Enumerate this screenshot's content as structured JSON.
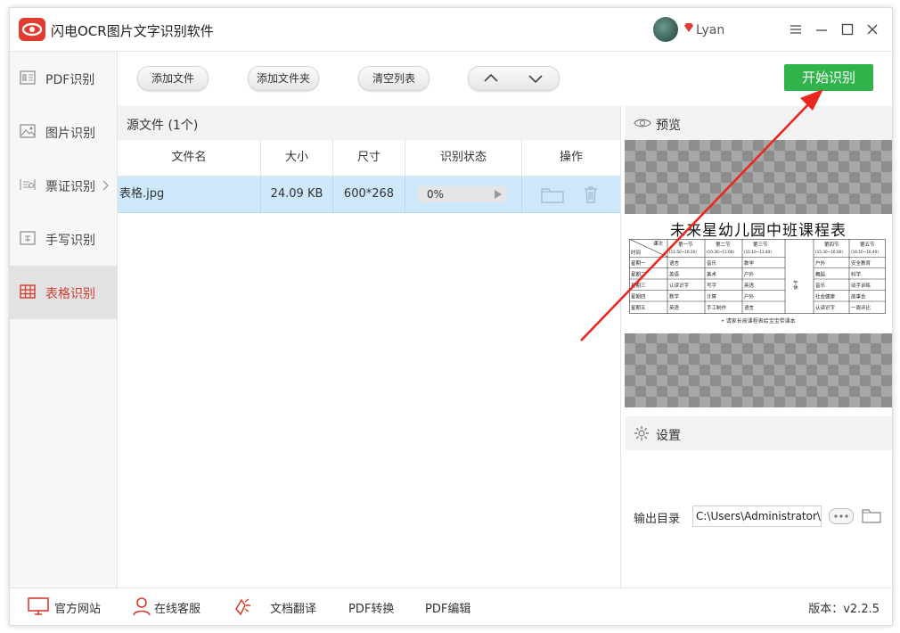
{
  "window": {
    "title": "闪电OCR图片文字识别软件",
    "username": "Lyan",
    "controls": [
      "menu",
      "minimize",
      "maximize",
      "close"
    ]
  },
  "sidebar": {
    "items": [
      {
        "label": "PDF识别",
        "icon": "pdf-icon",
        "active": false
      },
      {
        "label": "图片识别",
        "icon": "image-icon",
        "active": false
      },
      {
        "label": "票证识别",
        "icon": "id-card-icon",
        "active": false,
        "has_chevron": true
      },
      {
        "label": "手写识别",
        "icon": "handwriting-icon",
        "active": false
      },
      {
        "label": "表格识别",
        "icon": "table-icon",
        "active": true
      }
    ]
  },
  "toolbar": {
    "add_file": "添加文件",
    "add_folder": "添加文件夹",
    "clear_list": "清空列表",
    "start": "开始识别"
  },
  "file_list": {
    "header": "源文件 (1个)",
    "columns": [
      "文件名",
      "大小",
      "尺寸",
      "识别状态",
      "操作"
    ],
    "rows": [
      {
        "name": "表格.jpg",
        "size": "24.09 KB",
        "dimensions": "600*268",
        "progress": "0%"
      }
    ]
  },
  "preview": {
    "header": "预览",
    "doc_title": "未来星幼儿园中班课程表",
    "doc_note": "• 请家长按课程表给宝宝带课本",
    "table": {
      "corner_top": "课次",
      "corner_bottom": "时间",
      "headers": [
        {
          "label": "第一节",
          "time": "(11:50~10:20)"
        },
        {
          "label": "第二节",
          "time": "(10:30~11:00)"
        },
        {
          "label": "第三节",
          "time": "(11:10~11:40)"
        },
        {
          "label": "午休",
          "time": ""
        },
        {
          "label": "第四节",
          "time": "(15:30~16:00)"
        },
        {
          "label": "第五节",
          "time": "(16:10~16:40)"
        }
      ],
      "rows": [
        {
          "day": "星期一",
          "cells": [
            "语言",
            "音乐",
            "数学",
            "户外",
            "安全教育"
          ]
        },
        {
          "day": "星期二",
          "cells": [
            "英语",
            "美术",
            "户外",
            "舞蹈",
            "科学"
          ]
        },
        {
          "day": "星期三",
          "cells": [
            "认读识字",
            "写字",
            "英语",
            "音乐",
            "动手训练"
          ]
        },
        {
          "day": "星期四",
          "cells": [
            "数学",
            "计算",
            "户外",
            "社会健康",
            "故事会"
          ]
        },
        {
          "day": "星期五",
          "cells": [
            "英语",
            "手工制作",
            "语言",
            "认读识字",
            "一周评比"
          ]
        }
      ]
    }
  },
  "settings": {
    "header": "设置",
    "output_label": "输出目录",
    "output_path": "C:\\Users\\Administrator\\"
  },
  "footer": {
    "website": "官方网站",
    "support": "在线客服",
    "translate": "文档翻译",
    "pdf_convert": "PDF转换",
    "pdf_edit": "PDF编辑",
    "version": "版本：v2.2.5"
  },
  "colors": {
    "brand_red": "#e23b2f",
    "start_green": "#2fb34a",
    "row_highlight": "#cde8fa",
    "arrow_red": "#e8281f"
  }
}
